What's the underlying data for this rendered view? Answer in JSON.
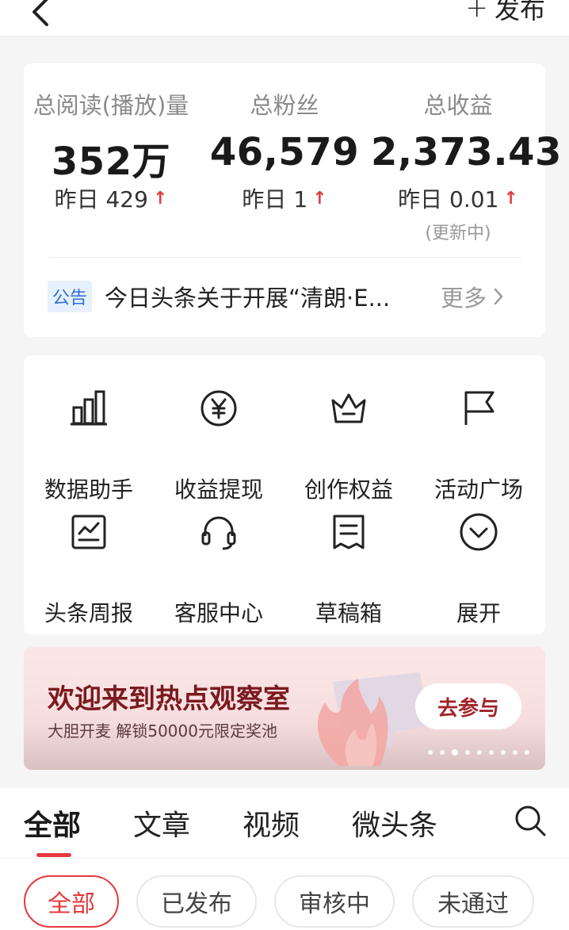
{
  "header": {
    "back_icon": "chevron-left-icon",
    "publish_label": "发布",
    "publish_icon": "plus-icon"
  },
  "stats": {
    "reads": {
      "label": "总阅读(播放)量",
      "value": "352万",
      "delta": "昨日 429"
    },
    "fans": {
      "label": "总粉丝",
      "value": "46,579",
      "delta": "昨日 1"
    },
    "income": {
      "label": "总收益",
      "value": "2,373.43",
      "delta": "昨日 0.01",
      "note": "(更新中)"
    },
    "up_arrow": "↑"
  },
  "notice": {
    "badge": "公告",
    "text": "今日头条关于开展“清朗·E...",
    "more": "更多"
  },
  "tools": [
    {
      "label": "数据助手",
      "icon": "bar-chart-icon"
    },
    {
      "label": "收益提现",
      "icon": "yen-coin-icon"
    },
    {
      "label": "创作权益",
      "icon": "crown-icon"
    },
    {
      "label": "活动广场",
      "icon": "flag-icon"
    },
    {
      "label": "头条周报",
      "icon": "report-chart-icon"
    },
    {
      "label": "客服中心",
      "icon": "headset-icon"
    },
    {
      "label": "草稿箱",
      "icon": "draft-icon"
    },
    {
      "label": "展开",
      "icon": "expand-down-icon"
    }
  ],
  "banner": {
    "title": "欢迎来到热点观察室",
    "subtitle": "大胆开麦 解锁50000元限定奖池",
    "button": "去参与",
    "dot_count": 9,
    "active_dot": 2
  },
  "content_tabs": {
    "items": [
      "全部",
      "文章",
      "视频",
      "微头条"
    ],
    "active": 0,
    "search_icon": "search-icon"
  },
  "filters": {
    "items": [
      "全部",
      "已发布",
      "审核中",
      "未通过"
    ],
    "active": 0
  },
  "colors": {
    "accent": "#e4393c",
    "notice_badge_bg": "#e7f0fd",
    "notice_badge_text": "#2f6ed6",
    "banner_title": "#7a1a1f"
  }
}
